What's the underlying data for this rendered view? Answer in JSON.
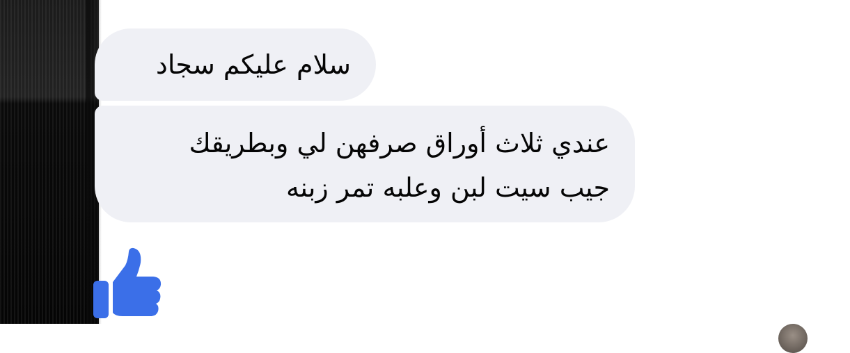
{
  "conversation": {
    "messages": [
      {
        "lines": [
          "سلام عليكم سجاد"
        ]
      },
      {
        "lines": [
          "عندي ثلاث أوراق صرفهن لي وبطريقك",
          "جيب سيت لبن وعلبه تمر زبنه"
        ]
      }
    ],
    "reaction_icon": "thumbs-up-icon",
    "colors": {
      "bubble_background": "#eff0f5",
      "text": "#050505",
      "like_blue": "#3b6fe8"
    }
  }
}
